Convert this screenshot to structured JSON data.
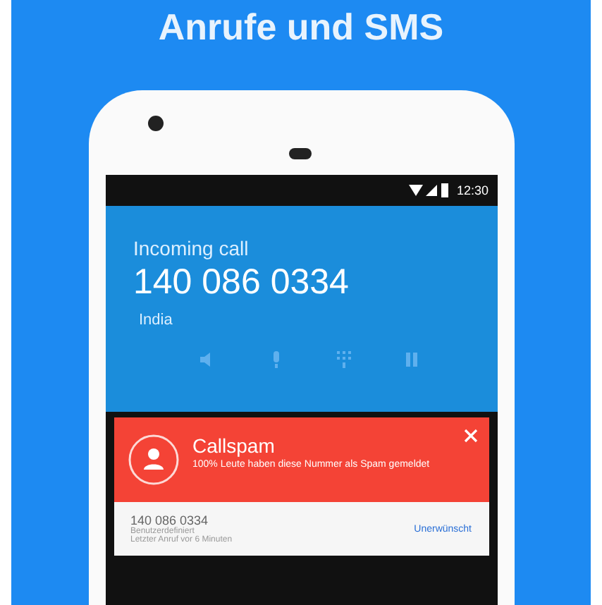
{
  "headline": "Anrufe und SMS",
  "status_bar": {
    "time": "12:30"
  },
  "call": {
    "label": "Incoming call",
    "number": "140 086 0334",
    "location": "India"
  },
  "spam_card": {
    "title": "Callspam",
    "message": "100% Leute haben diese Nummer als Spam gemeldet"
  },
  "caller_row": {
    "number": "140 086 0334",
    "line_1": "Benutzerdefiniert",
    "line_2": "Letzter Anruf vor 6 Minuten",
    "action": "Unerwünscht"
  }
}
